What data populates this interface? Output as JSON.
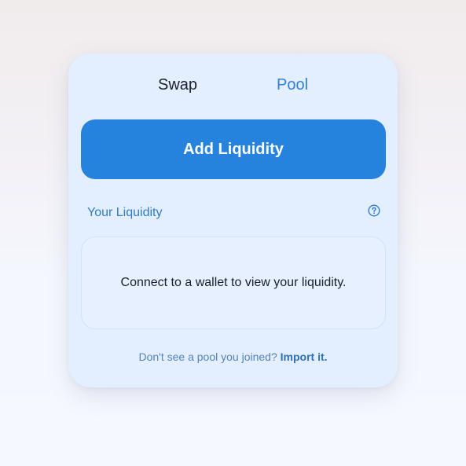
{
  "tabs": {
    "swap_label": "Swap",
    "pool_label": "Pool",
    "active": "Pool"
  },
  "actions": {
    "add_liquidity_label": "Add Liquidity"
  },
  "your_liquidity": {
    "title": "Your Liquidity",
    "help_icon": "question-circle-icon",
    "empty_message": "Connect to a wallet to view your liquidity."
  },
  "footer": {
    "prompt_text": "Don't see a pool you joined?",
    "import_link_label": "Import it."
  },
  "colors": {
    "accent": "#2683dd",
    "active_tab": "#2f80d6",
    "card_background": "#e3efff"
  }
}
